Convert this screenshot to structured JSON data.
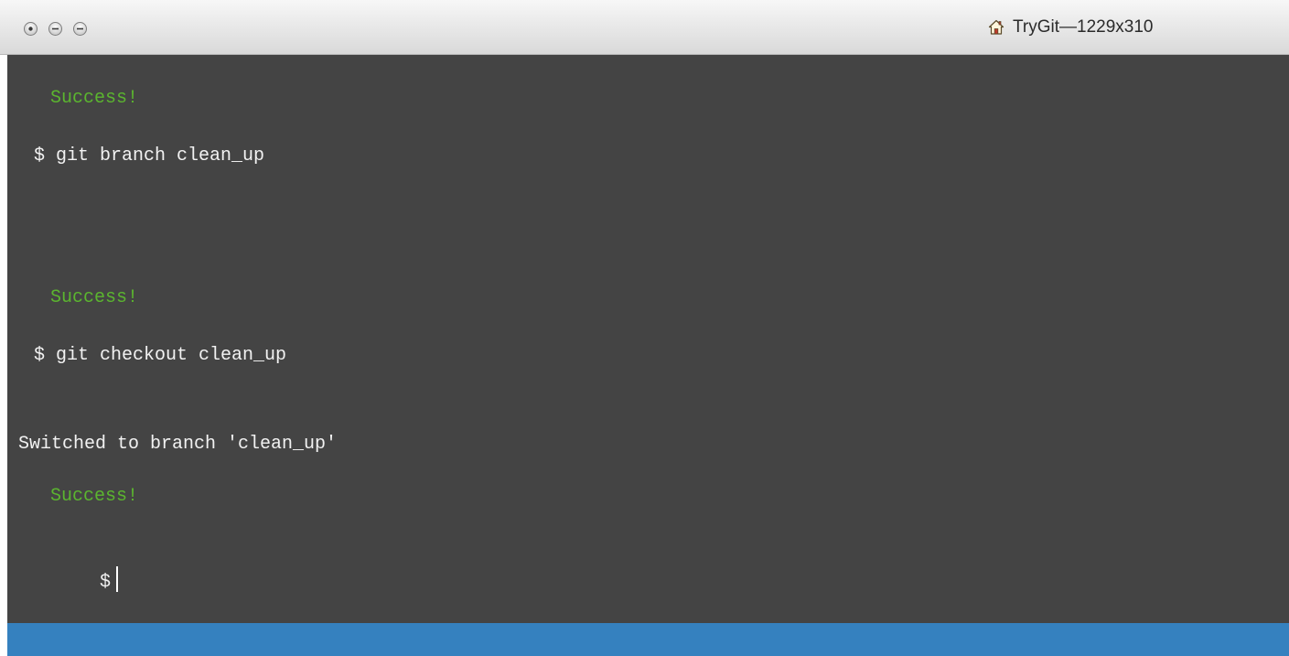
{
  "window": {
    "title": "TryGit—1229x310",
    "controls": {
      "close_icon": "close-icon",
      "minimize_icon": "minimize-icon",
      "zoom_icon": "zoom-icon"
    },
    "title_icon": "home-icon"
  },
  "terminal": {
    "lines": [
      {
        "kind": "success",
        "text": "Success!"
      },
      {
        "kind": "command",
        "text": "$ git branch clean_up"
      },
      {
        "kind": "success",
        "text": "Success!"
      },
      {
        "kind": "command",
        "text": "$ git checkout clean_up"
      },
      {
        "kind": "output",
        "text": "Switched to branch 'clean_up'"
      },
      {
        "kind": "success",
        "text": "Success!"
      }
    ],
    "prompt": "$",
    "input_value": ""
  },
  "colors": {
    "terminal_bg": "#444444",
    "success": "#5bb52f",
    "text": "#f2f2f2",
    "bottom_bar": "#3581bf"
  }
}
